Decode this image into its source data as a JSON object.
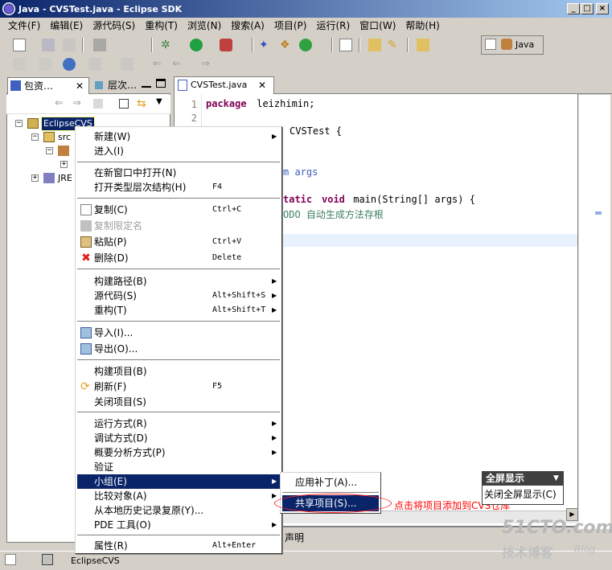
{
  "window": {
    "title": "Java - CVSTest.java - Eclipse SDK"
  },
  "menubar": [
    "文件(F)",
    "编辑(E)",
    "源代码(S)",
    "重构(T)",
    "浏览(N)",
    "搜索(A)",
    "项目(P)",
    "运行(R)",
    "窗口(W)",
    "帮助(H)"
  ],
  "perspective": {
    "label": "Java"
  },
  "left_view": {
    "tabs": [
      {
        "label": "包资…"
      },
      {
        "label": "层次…"
      }
    ],
    "tree": {
      "project": "EclipseCVS",
      "src": "src",
      "jre": "JRE"
    }
  },
  "editor": {
    "tab_label": "CVSTest.java",
    "line_numbers": [
      "1",
      "2"
    ],
    "lines": {
      "l1_kw": "package",
      "l1_rest": " leizhimin;",
      "l3": "CVSTest {",
      "l5": "m args",
      "l7_kw1": "tatic",
      "l7_kw2": "void",
      "l7_rest": " main(String[] args) {",
      "l8": "ODO 自动生成方法存根"
    }
  },
  "bottom_tab": {
    "label": "声明"
  },
  "status": {
    "text": "EclipseCVS"
  },
  "context_menu": {
    "items": [
      {
        "label": "新建(W)",
        "accel": "",
        "arrow": "▶"
      },
      {
        "label": "进入(I)",
        "accel": "",
        "arrow": ""
      },
      {
        "label": "在新窗口中打开(N)",
        "accel": "",
        "arrow": ""
      },
      {
        "label": "打开类型层次结构(H)",
        "accel": "F4",
        "arrow": ""
      },
      {
        "label": "复制(C)",
        "accel": "Ctrl+C",
        "arrow": ""
      },
      {
        "label": "复制限定名",
        "accel": "",
        "arrow": ""
      },
      {
        "label": "粘贴(P)",
        "accel": "Ctrl+V",
        "arrow": ""
      },
      {
        "label": "删除(D)",
        "accel": "Delete",
        "arrow": ""
      },
      {
        "label": "构建路径(B)",
        "accel": "",
        "arrow": "▶"
      },
      {
        "label": "源代码(S)",
        "accel": "Alt+Shift+S",
        "arrow": "▶"
      },
      {
        "label": "重构(T)",
        "accel": "Alt+Shift+T",
        "arrow": "▶"
      },
      {
        "label": "导入(I)...",
        "accel": "",
        "arrow": ""
      },
      {
        "label": "导出(O)...",
        "accel": "",
        "arrow": ""
      },
      {
        "label": "构建项目(B)",
        "accel": "",
        "arrow": ""
      },
      {
        "label": "刷新(F)",
        "accel": "F5",
        "arrow": ""
      },
      {
        "label": "关闭项目(S)",
        "accel": "",
        "arrow": ""
      },
      {
        "label": "运行方式(R)",
        "accel": "",
        "arrow": "▶"
      },
      {
        "label": "调试方式(D)",
        "accel": "",
        "arrow": "▶"
      },
      {
        "label": "概要分析方式(P)",
        "accel": "",
        "arrow": "▶"
      },
      {
        "label": "验证",
        "accel": "",
        "arrow": ""
      },
      {
        "label": "小组(E)",
        "accel": "",
        "arrow": "▶"
      },
      {
        "label": "比较对象(A)",
        "accel": "",
        "arrow": "▶"
      },
      {
        "label": "从本地历史记录复原(Y)...",
        "accel": "",
        "arrow": ""
      },
      {
        "label": "PDE 工具(O)",
        "accel": "",
        "arrow": "▶"
      },
      {
        "label": "属性(R)",
        "accel": "Alt+Enter",
        "arrow": ""
      }
    ]
  },
  "team_submenu": {
    "items": [
      {
        "label": "应用补丁(A)..."
      },
      {
        "label": "共享项目(S)..."
      }
    ]
  },
  "annotation": {
    "text": "点击将项目添加到CVS仓库"
  },
  "fullscreen_popup": {
    "title": "全屏显示",
    "item": "关闭全屏显示(C)"
  },
  "watermark": {
    "site": "51CTO.com",
    "subtitle": "技术博客",
    "blog": "Blog"
  },
  "colors": {
    "selection": "#0a246a",
    "keyword": "#7f0055",
    "comment": "#3f7f5f",
    "annotation": "#ff0000"
  }
}
